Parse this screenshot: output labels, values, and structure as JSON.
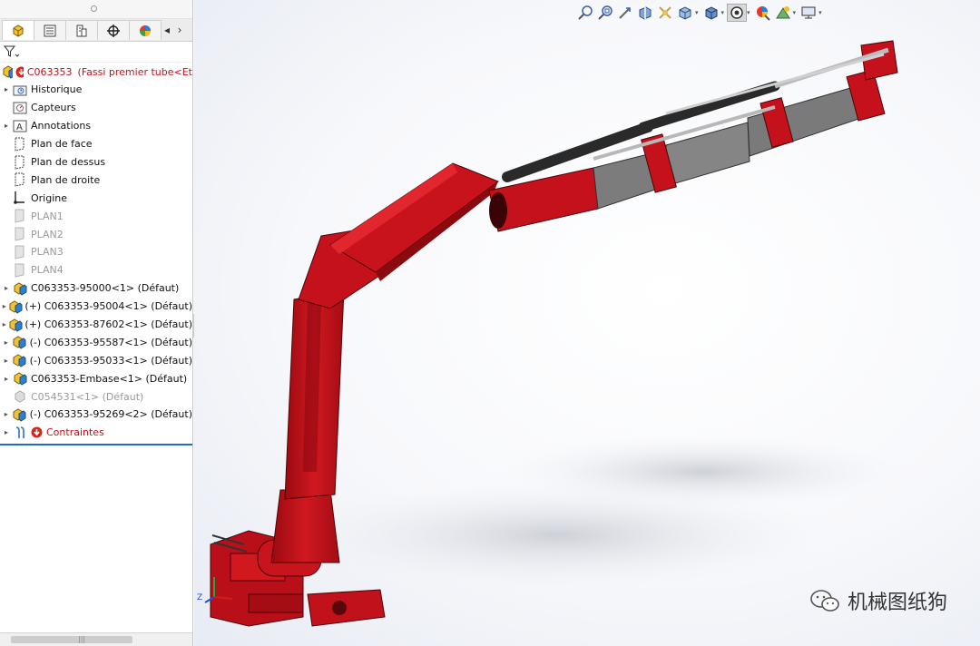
{
  "feature_tree": {
    "tabs": [
      {
        "name": "featuremanager-tab"
      },
      {
        "name": "propertymanager-tab"
      },
      {
        "name": "configurationmanager-tab"
      },
      {
        "name": "dimxpert-tab"
      },
      {
        "name": "display-manager-tab"
      }
    ],
    "root": {
      "label": "C063353",
      "config": "(Fassi premier tube<Et"
    },
    "items": [
      {
        "label": "Historique",
        "icon": "history-folder-icon",
        "expandable": true,
        "dim": false
      },
      {
        "label": "Capteurs",
        "icon": "sensors-icon",
        "expandable": false,
        "dim": false
      },
      {
        "label": "Annotations",
        "icon": "annotations-icon",
        "expandable": true,
        "dim": false
      },
      {
        "label": "Plan de face",
        "icon": "plane-icon",
        "expandable": false,
        "dim": false
      },
      {
        "label": "Plan de dessus",
        "icon": "plane-icon",
        "expandable": false,
        "dim": false
      },
      {
        "label": "Plan de droite",
        "icon": "plane-icon",
        "expandable": false,
        "dim": false
      },
      {
        "label": "Origine",
        "icon": "origin-icon",
        "expandable": false,
        "dim": false
      },
      {
        "label": "PLAN1",
        "icon": "hidden-plane-icon",
        "expandable": false,
        "dim": true
      },
      {
        "label": "PLAN2",
        "icon": "hidden-plane-icon",
        "expandable": false,
        "dim": true
      },
      {
        "label": "PLAN3",
        "icon": "hidden-plane-icon",
        "expandable": false,
        "dim": true
      },
      {
        "label": "PLAN4",
        "icon": "hidden-plane-icon",
        "expandable": false,
        "dim": true
      },
      {
        "label": "C063353-95000<1> (Défaut)",
        "icon": "subassembly-icon",
        "expandable": true,
        "dim": false
      },
      {
        "label": "(+) C063353-95004<1> (Défaut)",
        "icon": "subassembly-icon",
        "expandable": true,
        "dim": false
      },
      {
        "label": "(+) C063353-87602<1> (Défaut)",
        "icon": "subassembly-icon",
        "expandable": true,
        "dim": false
      },
      {
        "label": "(-) C063353-95587<1> (Défaut)",
        "icon": "subassembly-icon",
        "expandable": true,
        "dim": false
      },
      {
        "label": "(-) C063353-95033<1> (Défaut)",
        "icon": "subassembly-icon",
        "expandable": true,
        "dim": false
      },
      {
        "label": "C063353-Embase<1> (Défaut)",
        "icon": "subassembly-icon",
        "expandable": true,
        "dim": false
      },
      {
        "label": "C054531<1> (Défaut)",
        "icon": "suppressed-part-icon",
        "expandable": false,
        "dim": true
      },
      {
        "label": "(-) C063353-95269<2> (Défaut)",
        "icon": "subassembly-icon",
        "expandable": true,
        "dim": false
      },
      {
        "label": "Contraintes",
        "icon": "mates-icon",
        "expandable": true,
        "dim": false,
        "error": true
      }
    ]
  },
  "heads_up_toolbar": [
    {
      "name": "zoom-to-fit-icon"
    },
    {
      "name": "zoom-to-area-icon"
    },
    {
      "name": "previous-view-icon"
    },
    {
      "name": "section-view-icon"
    },
    {
      "name": "dynamic-annotation-icon"
    },
    {
      "name": "view-orientation-icon",
      "dropdown": true
    },
    {
      "name": "display-style-icon",
      "dropdown": true
    },
    {
      "name": "hide-show-items-icon",
      "dropdown": true,
      "active": true
    },
    {
      "name": "edit-appearance-icon"
    },
    {
      "name": "apply-scene-icon",
      "dropdown": true
    },
    {
      "name": "view-settings-icon",
      "dropdown": true
    }
  ],
  "triad": {
    "z_label": "Z"
  },
  "watermark": {
    "text": "机械图纸狗"
  },
  "colors": {
    "model_red": "#c4111b",
    "model_grey": "#7d7d7d",
    "error_red": "#c0141b",
    "selection_blue": "#1b6ec2"
  }
}
